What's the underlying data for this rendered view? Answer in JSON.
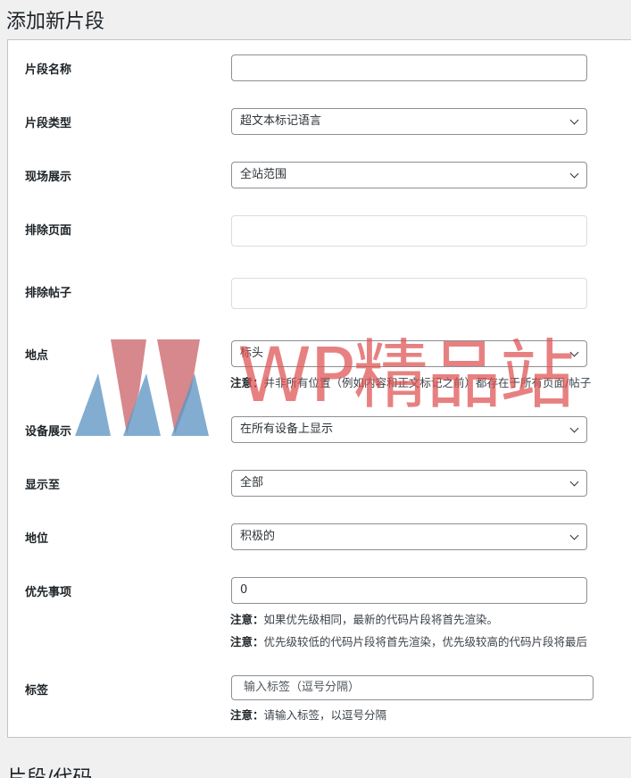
{
  "page": {
    "title": "添加新片段",
    "section_below": "片段/代码"
  },
  "form": {
    "name": {
      "label": "片段名称",
      "value": ""
    },
    "type": {
      "label": "片段类型",
      "value": "超文本标记语言"
    },
    "display": {
      "label": "现场展示",
      "value": "全站范围"
    },
    "exclude_pages": {
      "label": "排除页面",
      "value": ""
    },
    "exclude_posts": {
      "label": "排除帖子",
      "value": ""
    },
    "location": {
      "label": "地点",
      "value": "标头",
      "note_prefix": "注意：",
      "note": "并非所有位置（例如内容和正文标记之前）都存在于所有页面/帖子"
    },
    "device": {
      "label": "设备展示",
      "value": "在所有设备上显示"
    },
    "show_to": {
      "label": "显示至",
      "value": "全部"
    },
    "status": {
      "label": "地位",
      "value": "积极的"
    },
    "priority": {
      "label": "优先事项",
      "value": "0",
      "note1_prefix": "注意：",
      "note1": "如果优先级相同，最新的代码片段将首先渲染。",
      "note2_prefix": "注意：",
      "note2": "优先级较低的代码片段将首先渲染，优先级较高的代码片段将最后"
    },
    "tags": {
      "label": "标签",
      "placeholder": "输入标签（逗号分隔）",
      "note_prefix": "注意：",
      "note": "请输入标签，以逗号分隔"
    }
  },
  "watermark": {
    "text": "WP精品站"
  },
  "icons": {
    "select_arrow": "chevron-down-icon"
  }
}
